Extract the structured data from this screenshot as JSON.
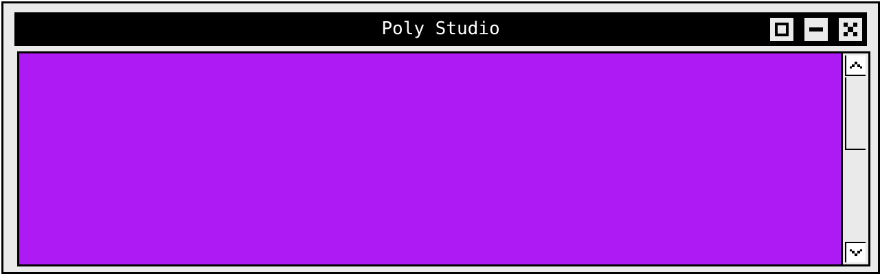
{
  "window": {
    "title": "Poly Studio",
    "controls": {
      "maximize": "maximize-icon",
      "minimize": "minimize-icon",
      "close": "close-icon"
    }
  },
  "canvas": {
    "color": "#ae1af4"
  },
  "scrollbar": {
    "up_icon": "chevron-up-icon",
    "down_icon": "chevron-down-icon",
    "position": 0
  }
}
